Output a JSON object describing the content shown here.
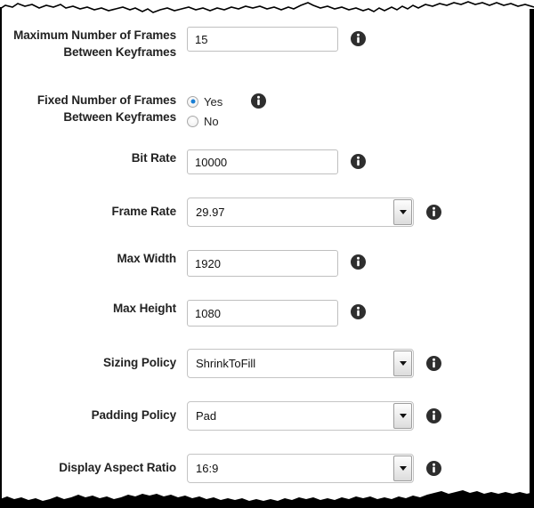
{
  "form": {
    "info_icon_name": "info-icon",
    "dropdown_icon_name": "chevron-down-icon",
    "fields": [
      {
        "id": "max-keyframes",
        "type": "text",
        "label": "Maximum Number of Frames Between Keyframes",
        "value": "15",
        "has_info": true
      },
      {
        "id": "fixed-keyframes",
        "type": "radio",
        "label": "Fixed Number of Frames Between Keyframes",
        "options": [
          "Yes",
          "No"
        ],
        "selected": "Yes",
        "has_info": true
      },
      {
        "id": "bit-rate",
        "type": "text",
        "label": "Bit Rate",
        "value": "10000",
        "has_info": true
      },
      {
        "id": "frame-rate",
        "type": "select",
        "label": "Frame Rate",
        "value": "29.97",
        "has_info": true
      },
      {
        "id": "max-width",
        "type": "text",
        "label": "Max Width",
        "value": "1920",
        "has_info": true
      },
      {
        "id": "max-height",
        "type": "text",
        "label": "Max Height",
        "value": "1080",
        "has_info": true
      },
      {
        "id": "sizing-policy",
        "type": "select",
        "label": "Sizing Policy",
        "value": "ShrinkToFill",
        "has_info": true
      },
      {
        "id": "padding-policy",
        "type": "select",
        "label": "Padding Policy",
        "value": "Pad",
        "has_info": true
      },
      {
        "id": "display-aspect-ratio",
        "type": "select",
        "label": "Display Aspect Ratio",
        "value": "16:9",
        "has_info": true
      }
    ]
  },
  "colors": {
    "label_text": "#222222",
    "input_border": "#bfbfbf",
    "radio_accent": "#1a7fd4",
    "info_icon": "#2e2e2e",
    "page_edge": "#000000"
  }
}
